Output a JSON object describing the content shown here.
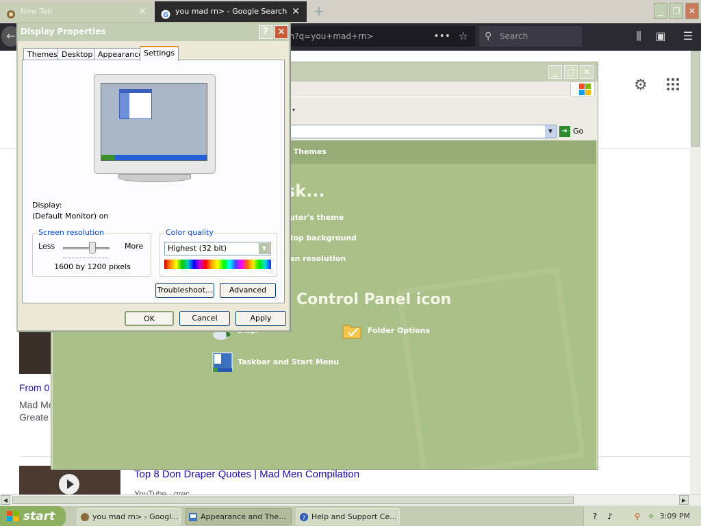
{
  "firefox": {
    "tabs": [
      {
        "label": "New Tab",
        "active": false
      },
      {
        "label": "you mad rn> - Google Search",
        "active": true
      }
    ],
    "new_tab_symbol": "+",
    "url_text": "ch?q=you+mad+rn>",
    "search_placeholder": "Search",
    "window_controls": {
      "minimize": "_",
      "restore": "❐",
      "close": "✕"
    }
  },
  "google": {
    "result1": {
      "title": "From 0",
      "desc_line1": "Mad Me",
      "desc_line2": "Greate"
    },
    "result2": {
      "title": "Top 8 Don Draper Quotes | Mad Men Compilation",
      "subtitle": "YouTube · grec"
    }
  },
  "control_panel": {
    "category_title": "d Themes",
    "pick_task_heading": "sk...",
    "tasks": [
      "uter's theme",
      "top background",
      "en resolution"
    ],
    "or_pick_heading": "Control Panel icon",
    "icons": [
      {
        "label": "Displ",
        "icon": "display-icon"
      },
      {
        "label": "Folder Options",
        "icon": "folder-options-icon"
      },
      {
        "label": "Taskbar and Start Menu",
        "icon": "taskbar-icon"
      }
    ],
    "go_label": "Go"
  },
  "display_properties": {
    "title": "Display Properties",
    "tabs": [
      "Themes",
      "Desktop",
      "Appearance",
      "Settings"
    ],
    "active_tab": "Settings",
    "display_label": "Display:",
    "display_value": "(Default Monitor) on",
    "screen_resolution": {
      "legend": "Screen resolution",
      "less": "Less",
      "more": "More",
      "value": "1600 by 1200 pixels"
    },
    "color_quality": {
      "legend": "Color quality",
      "selected": "Highest (32 bit)"
    },
    "buttons": {
      "troubleshoot": "Troubleshoot...",
      "advanced": "Advanced",
      "ok": "OK",
      "cancel": "Cancel",
      "apply": "Apply"
    }
  },
  "taskbar": {
    "start_label": "start",
    "items": [
      {
        "label": "you mad rn> - Googl...",
        "active": false
      },
      {
        "label": "Appearance and The...",
        "active": true
      },
      {
        "label": "Help and Support Ce...",
        "active": false
      }
    ],
    "clock": "3:09 PM"
  }
}
